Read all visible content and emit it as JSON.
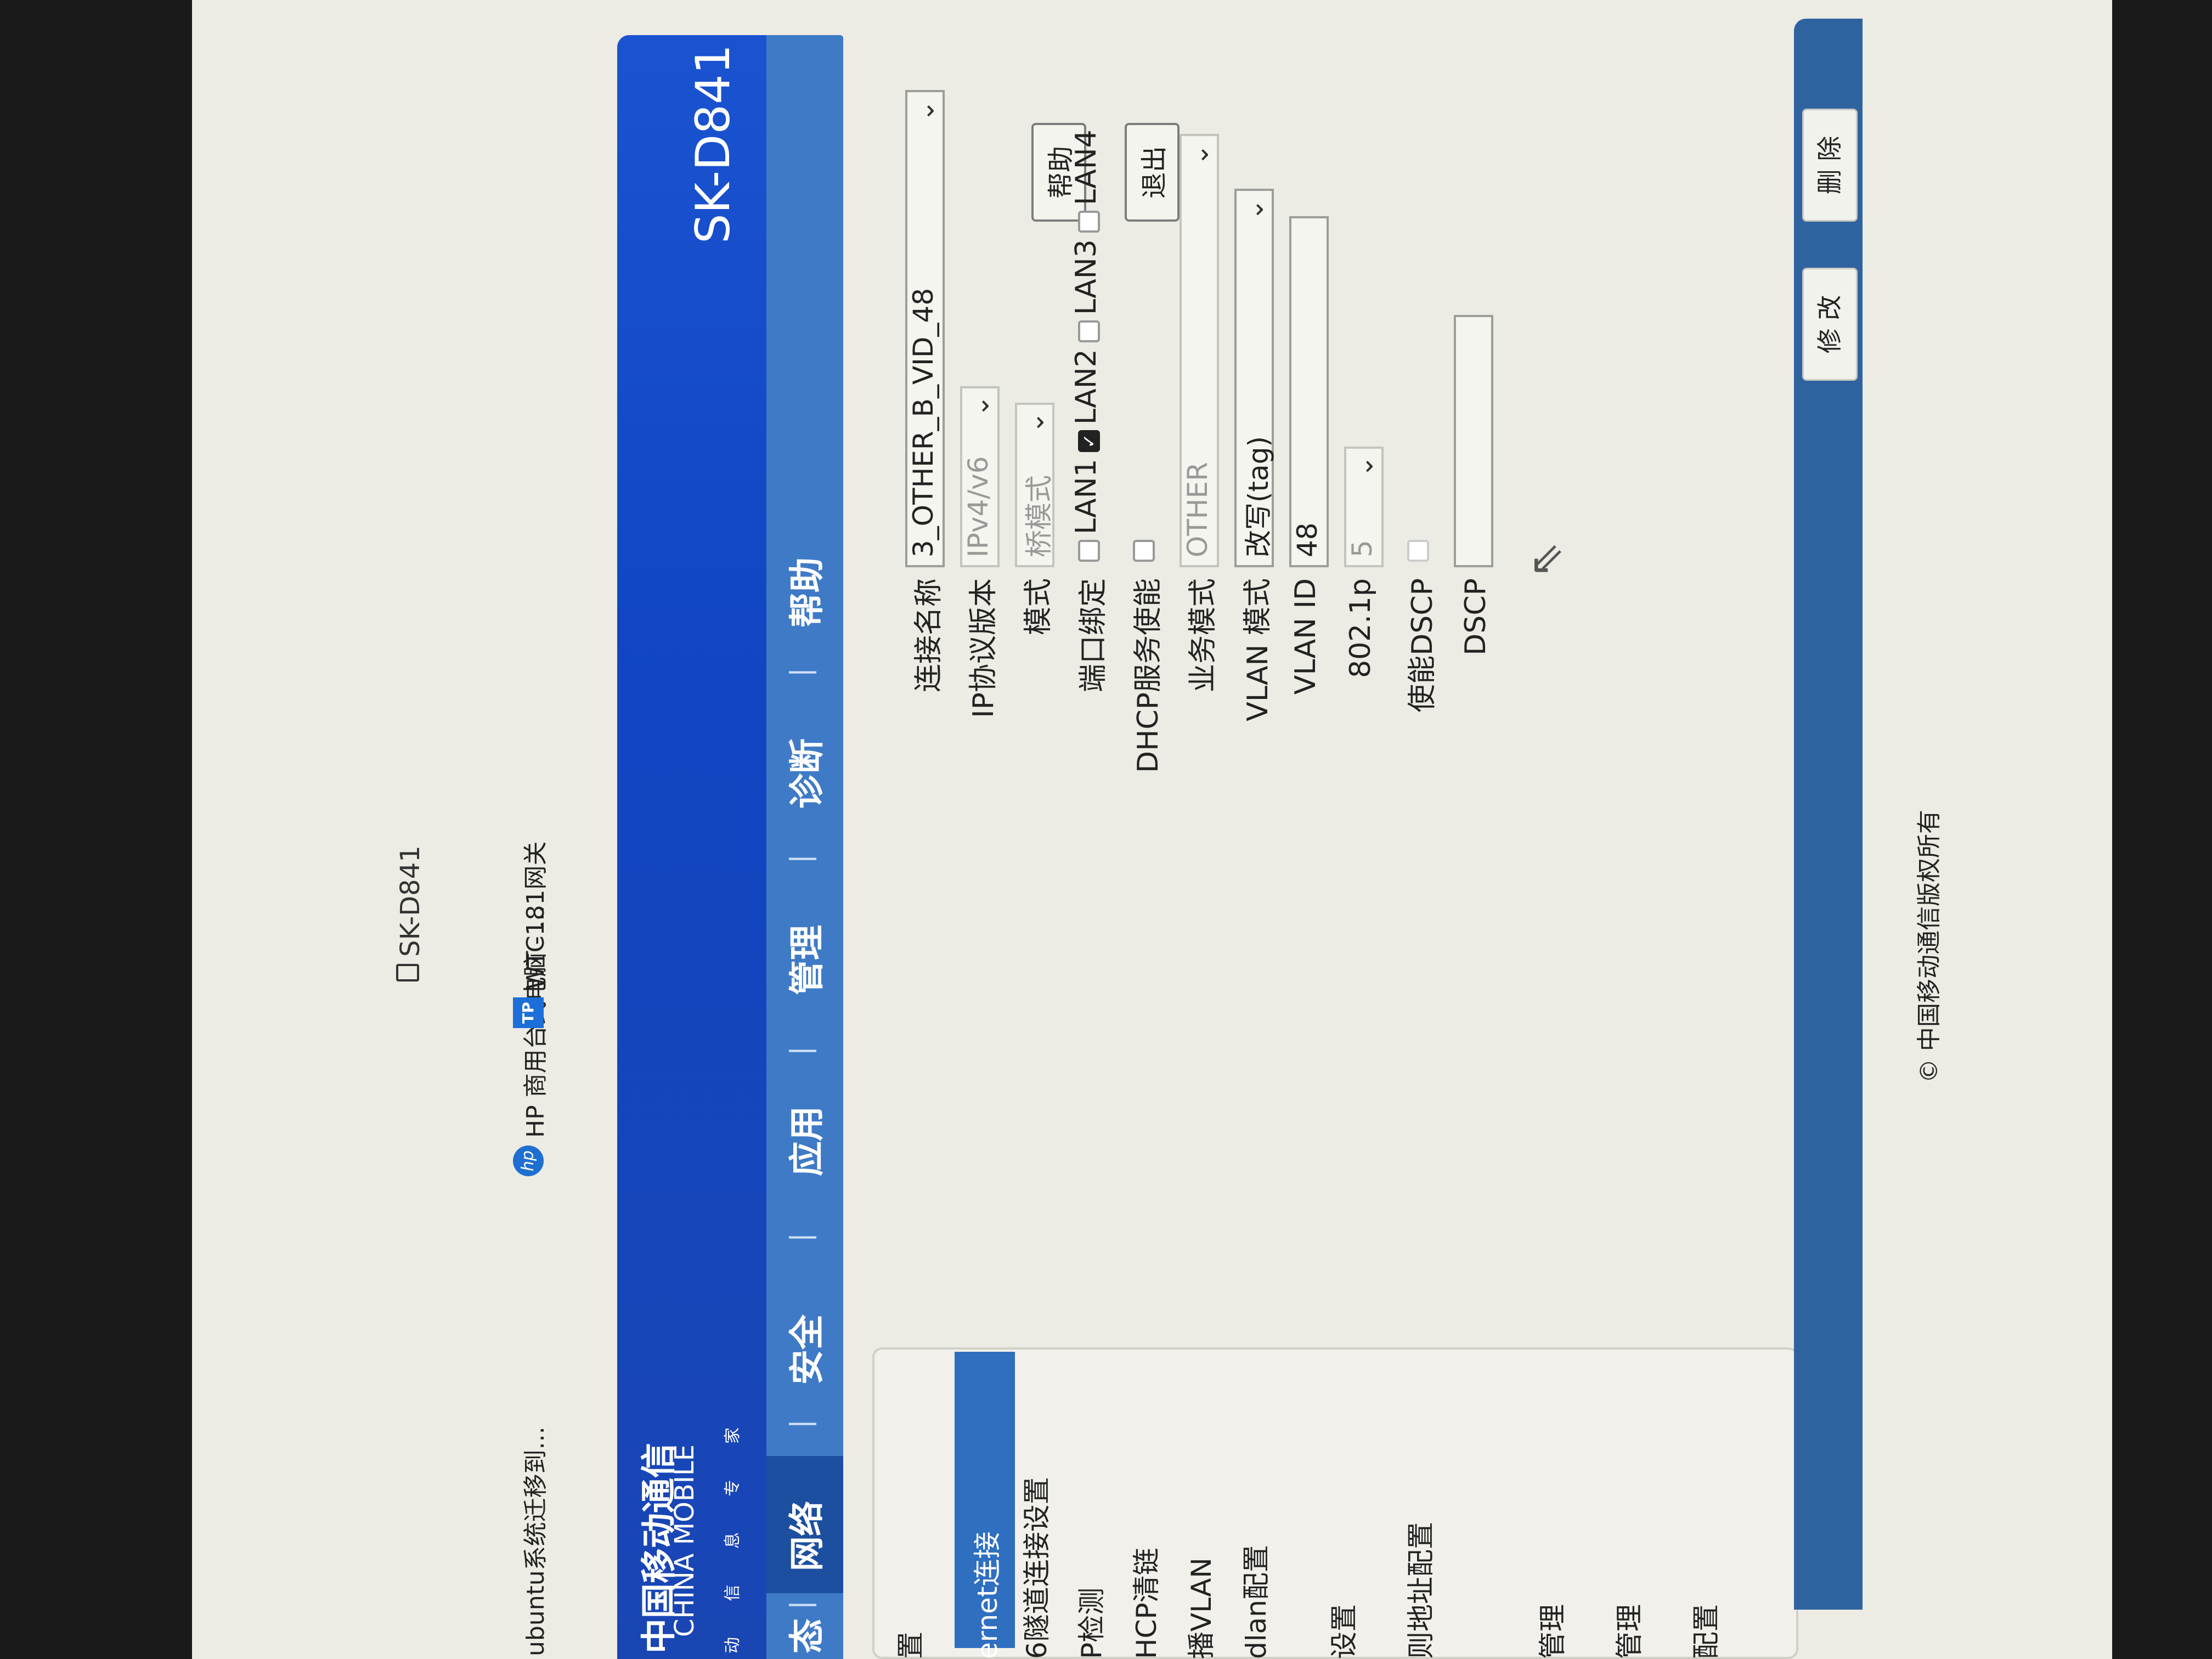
{
  "browser": {
    "tab_title": "SK-D841",
    "bookmarks": [
      "ubuntu系统迁移到...",
      "HP 商用台式电脑 - ...",
      "WTC181网关"
    ],
    "bookmark_icons": [
      "hp-icon",
      "tp-icon"
    ],
    "hp_icon_text": "hp",
    "tp_icon_text": "TP"
  },
  "header": {
    "logo_cn": "中国移动通信",
    "logo_en": "CHINA MOBILE",
    "logo_sub": "动 信 息 专 家",
    "model": "SK-D841",
    "help_btn": "帮助",
    "exit_btn": "退出"
  },
  "nav": {
    "items": [
      "态",
      "网络",
      "安全",
      "应用",
      "管理",
      "诊断",
      "帮助"
    ],
    "active": "网络"
  },
  "sidebar": {
    "items": [
      "置",
      "ernet连接",
      "6隧道连接设置",
      "P检测",
      "HCP清链",
      "播VLAN",
      "dlan配置",
      "设置",
      "则地址配置",
      "管理",
      "管理",
      "配置"
    ],
    "active_index": 1
  },
  "form": {
    "connection_name_label": "连接名称",
    "connection_name_value": "3_OTHER_B_VID_48",
    "ip_version_label": "IP协议版本",
    "ip_version_value": "IPv4/v6",
    "mode_label": "模式",
    "mode_value": "桥模式",
    "port_binding_label": "端口绑定",
    "ports": [
      {
        "label": "LAN1",
        "checked": false
      },
      {
        "label": "LAN2",
        "checked": true
      },
      {
        "label": "LAN3",
        "checked": false
      },
      {
        "label": "LAN4",
        "checked": false
      }
    ],
    "dhcp_label": "DHCP服务使能",
    "service_mode_label": "业务模式",
    "service_mode_value": "OTHER",
    "vlan_mode_label": "VLAN 模式",
    "vlan_mode_value": "改写(tag)",
    "vlan_id_label": "VLAN ID",
    "vlan_id_value": "48",
    "p8021_label": "802.1p",
    "p8021_value": "5",
    "dscp_enable_label": "使能DSCP",
    "dscp_label": "DSCP",
    "dscp_value": ""
  },
  "footer": {
    "modify_btn": "修 改",
    "delete_btn": "删 除",
    "copyright": "© 中国移动通信版权所有"
  }
}
